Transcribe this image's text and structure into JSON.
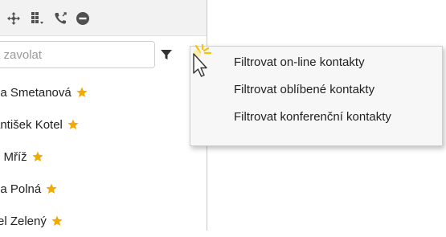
{
  "toolbar": {
    "icons": [
      "move-icon",
      "dialpad-icon",
      "phone-forward-icon",
      "minus-circle-icon"
    ]
  },
  "search": {
    "placeholder": "a zavolat",
    "value": ""
  },
  "contacts": [
    {
      "name": "na Smetanová",
      "favorite": true
    },
    {
      "name": "antišek Kotel",
      "favorite": true
    },
    {
      "name": "n Mříž",
      "favorite": true
    },
    {
      "name": "na Polná",
      "favorite": true
    },
    {
      "name": "rel Zelený",
      "favorite": true
    }
  ],
  "menu": {
    "items": [
      {
        "label": "Filtrovat on-line kontakty"
      },
      {
        "label": "Filtrovat oblíbené kontakty"
      },
      {
        "label": "Filtrovat konferenční kontakty"
      }
    ]
  },
  "colors": {
    "star": "#f2a900",
    "icon": "#505050",
    "menu_bg": "#f7f7f7",
    "toolbar_bg": "#f2f2f2"
  }
}
